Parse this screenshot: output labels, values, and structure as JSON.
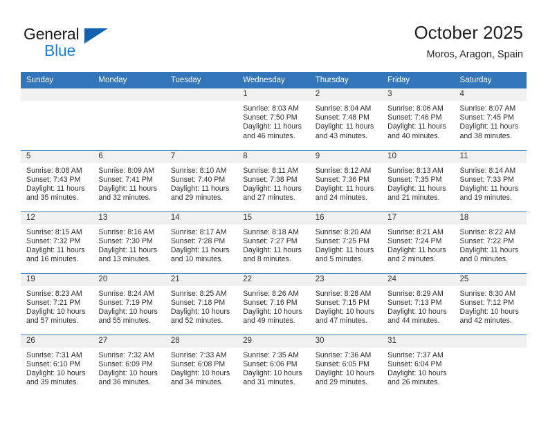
{
  "brand": {
    "name_part1": "General",
    "name_part2": "Blue",
    "triangle_color": "#1263ad",
    "blue_color": "#1a7fd4"
  },
  "header": {
    "title": "October 2025",
    "location": "Moros, Aragon, Spain"
  },
  "theme": {
    "header_bg": "#3275b8",
    "daynum_bg": "#f0f0f0",
    "row_border": "#3275b8"
  },
  "weekday_headers": [
    "Sunday",
    "Monday",
    "Tuesday",
    "Wednesday",
    "Thursday",
    "Friday",
    "Saturday"
  ],
  "labels": {
    "sunrise_prefix": "Sunrise:",
    "sunset_prefix": "Sunset:",
    "daylight_prefix": "Daylight:"
  },
  "weeks": [
    [
      {
        "day": "",
        "empty": true
      },
      {
        "day": "",
        "empty": true
      },
      {
        "day": "",
        "empty": true
      },
      {
        "day": "1",
        "sunrise": "Sunrise: 8:03 AM",
        "sunset": "Sunset: 7:50 PM",
        "daylight_l1": "Daylight: 11 hours",
        "daylight_l2": "and 46 minutes."
      },
      {
        "day": "2",
        "sunrise": "Sunrise: 8:04 AM",
        "sunset": "Sunset: 7:48 PM",
        "daylight_l1": "Daylight: 11 hours",
        "daylight_l2": "and 43 minutes."
      },
      {
        "day": "3",
        "sunrise": "Sunrise: 8:06 AM",
        "sunset": "Sunset: 7:46 PM",
        "daylight_l1": "Daylight: 11 hours",
        "daylight_l2": "and 40 minutes."
      },
      {
        "day": "4",
        "sunrise": "Sunrise: 8:07 AM",
        "sunset": "Sunset: 7:45 PM",
        "daylight_l1": "Daylight: 11 hours",
        "daylight_l2": "and 38 minutes."
      }
    ],
    [
      {
        "day": "5",
        "sunrise": "Sunrise: 8:08 AM",
        "sunset": "Sunset: 7:43 PM",
        "daylight_l1": "Daylight: 11 hours",
        "daylight_l2": "and 35 minutes."
      },
      {
        "day": "6",
        "sunrise": "Sunrise: 8:09 AM",
        "sunset": "Sunset: 7:41 PM",
        "daylight_l1": "Daylight: 11 hours",
        "daylight_l2": "and 32 minutes."
      },
      {
        "day": "7",
        "sunrise": "Sunrise: 8:10 AM",
        "sunset": "Sunset: 7:40 PM",
        "daylight_l1": "Daylight: 11 hours",
        "daylight_l2": "and 29 minutes."
      },
      {
        "day": "8",
        "sunrise": "Sunrise: 8:11 AM",
        "sunset": "Sunset: 7:38 PM",
        "daylight_l1": "Daylight: 11 hours",
        "daylight_l2": "and 27 minutes."
      },
      {
        "day": "9",
        "sunrise": "Sunrise: 8:12 AM",
        "sunset": "Sunset: 7:36 PM",
        "daylight_l1": "Daylight: 11 hours",
        "daylight_l2": "and 24 minutes."
      },
      {
        "day": "10",
        "sunrise": "Sunrise: 8:13 AM",
        "sunset": "Sunset: 7:35 PM",
        "daylight_l1": "Daylight: 11 hours",
        "daylight_l2": "and 21 minutes."
      },
      {
        "day": "11",
        "sunrise": "Sunrise: 8:14 AM",
        "sunset": "Sunset: 7:33 PM",
        "daylight_l1": "Daylight: 11 hours",
        "daylight_l2": "and 19 minutes."
      }
    ],
    [
      {
        "day": "12",
        "sunrise": "Sunrise: 8:15 AM",
        "sunset": "Sunset: 7:32 PM",
        "daylight_l1": "Daylight: 11 hours",
        "daylight_l2": "and 16 minutes."
      },
      {
        "day": "13",
        "sunrise": "Sunrise: 8:16 AM",
        "sunset": "Sunset: 7:30 PM",
        "daylight_l1": "Daylight: 11 hours",
        "daylight_l2": "and 13 minutes."
      },
      {
        "day": "14",
        "sunrise": "Sunrise: 8:17 AM",
        "sunset": "Sunset: 7:28 PM",
        "daylight_l1": "Daylight: 11 hours",
        "daylight_l2": "and 10 minutes."
      },
      {
        "day": "15",
        "sunrise": "Sunrise: 8:18 AM",
        "sunset": "Sunset: 7:27 PM",
        "daylight_l1": "Daylight: 11 hours",
        "daylight_l2": "and 8 minutes."
      },
      {
        "day": "16",
        "sunrise": "Sunrise: 8:20 AM",
        "sunset": "Sunset: 7:25 PM",
        "daylight_l1": "Daylight: 11 hours",
        "daylight_l2": "and 5 minutes."
      },
      {
        "day": "17",
        "sunrise": "Sunrise: 8:21 AM",
        "sunset": "Sunset: 7:24 PM",
        "daylight_l1": "Daylight: 11 hours",
        "daylight_l2": "and 2 minutes."
      },
      {
        "day": "18",
        "sunrise": "Sunrise: 8:22 AM",
        "sunset": "Sunset: 7:22 PM",
        "daylight_l1": "Daylight: 11 hours",
        "daylight_l2": "and 0 minutes."
      }
    ],
    [
      {
        "day": "19",
        "sunrise": "Sunrise: 8:23 AM",
        "sunset": "Sunset: 7:21 PM",
        "daylight_l1": "Daylight: 10 hours",
        "daylight_l2": "and 57 minutes."
      },
      {
        "day": "20",
        "sunrise": "Sunrise: 8:24 AM",
        "sunset": "Sunset: 7:19 PM",
        "daylight_l1": "Daylight: 10 hours",
        "daylight_l2": "and 55 minutes."
      },
      {
        "day": "21",
        "sunrise": "Sunrise: 8:25 AM",
        "sunset": "Sunset: 7:18 PM",
        "daylight_l1": "Daylight: 10 hours",
        "daylight_l2": "and 52 minutes."
      },
      {
        "day": "22",
        "sunrise": "Sunrise: 8:26 AM",
        "sunset": "Sunset: 7:16 PM",
        "daylight_l1": "Daylight: 10 hours",
        "daylight_l2": "and 49 minutes."
      },
      {
        "day": "23",
        "sunrise": "Sunrise: 8:28 AM",
        "sunset": "Sunset: 7:15 PM",
        "daylight_l1": "Daylight: 10 hours",
        "daylight_l2": "and 47 minutes."
      },
      {
        "day": "24",
        "sunrise": "Sunrise: 8:29 AM",
        "sunset": "Sunset: 7:13 PM",
        "daylight_l1": "Daylight: 10 hours",
        "daylight_l2": "and 44 minutes."
      },
      {
        "day": "25",
        "sunrise": "Sunrise: 8:30 AM",
        "sunset": "Sunset: 7:12 PM",
        "daylight_l1": "Daylight: 10 hours",
        "daylight_l2": "and 42 minutes."
      }
    ],
    [
      {
        "day": "26",
        "sunrise": "Sunrise: 7:31 AM",
        "sunset": "Sunset: 6:10 PM",
        "daylight_l1": "Daylight: 10 hours",
        "daylight_l2": "and 39 minutes."
      },
      {
        "day": "27",
        "sunrise": "Sunrise: 7:32 AM",
        "sunset": "Sunset: 6:09 PM",
        "daylight_l1": "Daylight: 10 hours",
        "daylight_l2": "and 36 minutes."
      },
      {
        "day": "28",
        "sunrise": "Sunrise: 7:33 AM",
        "sunset": "Sunset: 6:08 PM",
        "daylight_l1": "Daylight: 10 hours",
        "daylight_l2": "and 34 minutes."
      },
      {
        "day": "29",
        "sunrise": "Sunrise: 7:35 AM",
        "sunset": "Sunset: 6:06 PM",
        "daylight_l1": "Daylight: 10 hours",
        "daylight_l2": "and 31 minutes."
      },
      {
        "day": "30",
        "sunrise": "Sunrise: 7:36 AM",
        "sunset": "Sunset: 6:05 PM",
        "daylight_l1": "Daylight: 10 hours",
        "daylight_l2": "and 29 minutes."
      },
      {
        "day": "31",
        "sunrise": "Sunrise: 7:37 AM",
        "sunset": "Sunset: 6:04 PM",
        "daylight_l1": "Daylight: 10 hours",
        "daylight_l2": "and 26 minutes."
      },
      {
        "day": "",
        "empty": true
      }
    ]
  ]
}
